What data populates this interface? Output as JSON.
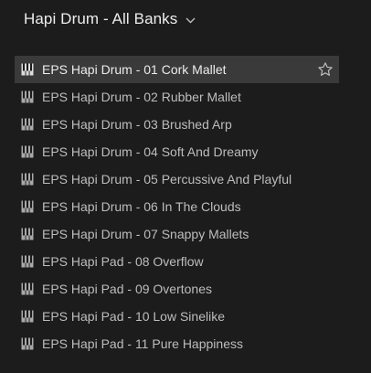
{
  "header": {
    "title": "Hapi Drum - All Banks"
  },
  "presets": [
    {
      "label": "EPS Hapi Drum - 01 Cork Mallet",
      "selected": true
    },
    {
      "label": "EPS Hapi Drum - 02 Rubber Mallet"
    },
    {
      "label": "EPS Hapi Drum - 03 Brushed Arp"
    },
    {
      "label": "EPS Hapi Drum - 04 Soft And Dreamy"
    },
    {
      "label": "EPS Hapi Drum - 05 Percussive And Playful"
    },
    {
      "label": "EPS Hapi Drum - 06 In The Clouds"
    },
    {
      "label": "EPS Hapi Drum - 07 Snappy Mallets"
    },
    {
      "label": "EPS Hapi Pad - 08 Overflow"
    },
    {
      "label": "EPS Hapi Pad - 09 Overtones"
    },
    {
      "label": "EPS Hapi Pad - 10 Low Sinelike"
    },
    {
      "label": "EPS Hapi Pad - 11 Pure Happiness"
    }
  ],
  "icons": {
    "preset": "piano-keys-icon",
    "favorite": "star-outline-icon",
    "dropdown": "chevron-down-icon"
  }
}
